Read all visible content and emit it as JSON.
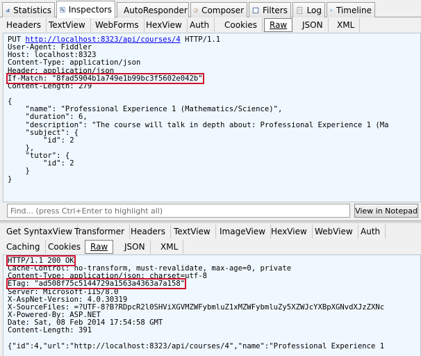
{
  "top_tabs": [
    {
      "label": "Statistics",
      "icon": "statistics-icon"
    },
    {
      "label": "Inspectors",
      "icon": "inspectors-icon"
    },
    {
      "label": "AutoResponder",
      "icon": "lightning-icon"
    },
    {
      "label": "Composer",
      "icon": "composer-icon"
    },
    {
      "label": "Filters",
      "icon": "checkbox-icon"
    },
    {
      "label": "Log",
      "icon": "log-icon"
    },
    {
      "label": "Timeline",
      "icon": "timeline-icon"
    }
  ],
  "request_tabs": [
    "Headers",
    "TextView",
    "WebForms",
    "HexView",
    "Auth",
    "Cookies",
    "Raw",
    "JSON",
    "XML"
  ],
  "request_active_tab": "Raw",
  "request": {
    "method": "PUT",
    "url": "http://localhost:8323/api/courses/4",
    "protocol": "HTTP/1.1",
    "lines": [
      "User-Agent: Fiddler",
      "Host: localhost:8323",
      "Content-Type: application/json",
      "Header: application/json",
      "If-Match: \"8fad5904b1a749e1b99bc3f5602e042b\"",
      "Content-Length: 279",
      "",
      "{",
      "    \"name\": \"Professional Experience 1 (Mathematics/Science)\",",
      "    \"duration\": 6,",
      "    \"description\": \"The course will talk in depth about: Professional Experience 1 (Ma",
      "    \"subject\": {",
      "        \"id\": 2",
      "    },",
      "    \"tutor\": {",
      "        \"id\": 2",
      "    }",
      "}"
    ]
  },
  "find": {
    "placeholder": "Find... (press Ctrl+Enter to highlight all)",
    "button_label": "View in Notepad"
  },
  "response_tabs_row1": [
    "Get SyntaxView",
    "Transformer",
    "Headers",
    "TextView",
    "ImageView",
    "HexView",
    "WebView",
    "Auth"
  ],
  "response_tabs_row2": [
    "Caching",
    "Cookies",
    "Raw",
    "JSON",
    "XML"
  ],
  "response_active_tab": "Raw",
  "response": {
    "lines": [
      "HTTP/1.1 200 OK",
      "Cache-Control: no-transform, must-revalidate, max-age=0, private",
      "Content-Type: application/json; charset=utf-8",
      "ETag: \"ad508f75c5144729a1563a4363a7a158\"",
      "Server: Microsoft-IIS/8.0",
      "X-AspNet-Version: 4.0.30319",
      "X-SourceFiles: =?UTF-8?B?RDpcR2l0SHViXGVMZWFybmluZ1xMZWFybmluZy5XZWJcYXBpXGNvdXJzZXNc",
      "X-Powered-By: ASP.NET",
      "Date: Sat, 08 Feb 2014 17:54:58 GMT",
      "Content-Length: 391",
      "",
      "{\"id\":4,\"url\":\"http://localhost:8323/api/courses/4\",\"name\":\"Professional Experience 1"
    ]
  }
}
